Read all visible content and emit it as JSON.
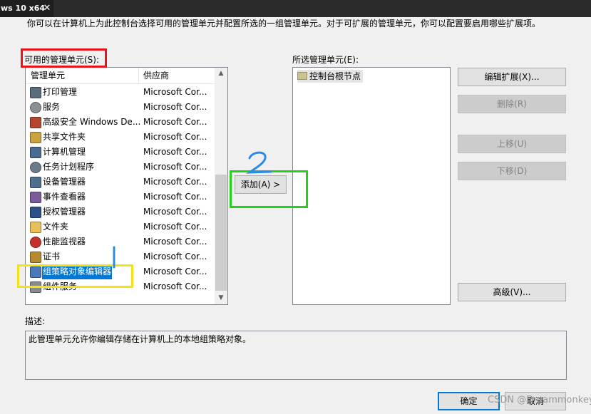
{
  "vm_tab": {
    "title": "ws 10 x64",
    "close_glyph": "✕"
  },
  "dialog": {
    "intro": "你可以在计算机上为此控制台选择可用的管理单元并配置所选的一组管理单元。对于可扩展的管理单元，你可以配置要启用哪些扩展项。",
    "available_label": "可用的管理单元(S):",
    "selected_label": "所选管理单元(E):",
    "description_label": "描述:",
    "description_text": "此管理单元允许你编辑存储在计算机上的本地组策略对象。"
  },
  "available_list": {
    "columns": [
      "管理单元",
      "供应商"
    ],
    "rows": [
      {
        "name": "打印管理",
        "vendor": "Microsoft Cor...",
        "icon": "printer-icon",
        "color": "#5a6b7d"
      },
      {
        "name": "服务",
        "vendor": "Microsoft Cor...",
        "icon": "gear-icon",
        "color": "#8a8f96"
      },
      {
        "name": "高级安全 Windows De...",
        "vendor": "Microsoft Cor...",
        "icon": "firewall-icon",
        "color": "#b4462f"
      },
      {
        "name": "共享文件夹",
        "vendor": "Microsoft Cor...",
        "icon": "shared-folder-icon",
        "color": "#caa23e"
      },
      {
        "name": "计算机管理",
        "vendor": "Microsoft Cor...",
        "icon": "computer-management-icon",
        "color": "#4a6a93"
      },
      {
        "name": "任务计划程序",
        "vendor": "Microsoft Cor...",
        "icon": "clock-icon",
        "color": "#6b7b8a"
      },
      {
        "name": "设备管理器",
        "vendor": "Microsoft Cor...",
        "icon": "device-manager-icon",
        "color": "#4e6e8e"
      },
      {
        "name": "事件查看器",
        "vendor": "Microsoft Cor...",
        "icon": "event-viewer-icon",
        "color": "#7a5c9a"
      },
      {
        "name": "授权管理器",
        "vendor": "Microsoft Cor...",
        "icon": "authorization-icon",
        "color": "#2d4f8a"
      },
      {
        "name": "文件夹",
        "vendor": "Microsoft Cor...",
        "icon": "folder-icon",
        "color": "#e6c15a"
      },
      {
        "name": "性能监视器",
        "vendor": "Microsoft Cor...",
        "icon": "performance-icon",
        "color": "#c4302b"
      },
      {
        "name": "证书",
        "vendor": "Microsoft Cor...",
        "icon": "certificate-icon",
        "color": "#b88a2e"
      },
      {
        "name": "组策略对象编辑器",
        "vendor": "Microsoft Cor...",
        "icon": "group-policy-icon",
        "color": "#4a78b8",
        "selected": true
      },
      {
        "name": "组件服务",
        "vendor": "Microsoft Cor...",
        "icon": "component-services-icon",
        "color": "#8a8a8a"
      }
    ]
  },
  "selected_list": {
    "root": "控制台根节点",
    "root_icon": "folder-icon"
  },
  "buttons": {
    "add": "添加(A) >",
    "edit_extensions": "编辑扩展(X)...",
    "remove": "删除(R)",
    "move_up": "上移(U)",
    "move_down": "下移(D)",
    "advanced": "高级(V)...",
    "ok": "确定",
    "cancel": "取消"
  },
  "annotations": {
    "one": "1",
    "two": "2",
    "colors": {
      "red": "#e8131b",
      "green": "#22d11c",
      "yellow": "#f5e11a",
      "blue": "#2b8ce8"
    }
  },
  "watermark": "CSDN @Dreammonkey"
}
